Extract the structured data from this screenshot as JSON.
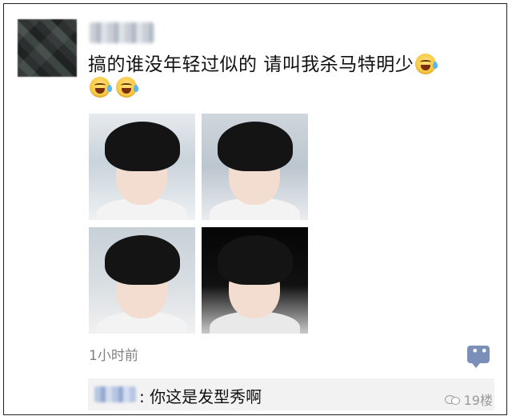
{
  "post": {
    "username": "",
    "text": "搞的谁没年轻过似的 请叫我杀马特明少",
    "emojis": [
      "laugh-cry-emoji",
      "laugh-cry-emoji",
      "laugh-cry-emoji"
    ],
    "photos": [
      {
        "name": "selfie-photo-1"
      },
      {
        "name": "selfie-photo-2"
      },
      {
        "name": "selfie-photo-3"
      },
      {
        "name": "selfie-photo-4"
      }
    ],
    "timestamp": "1小时前"
  },
  "comment": {
    "commenter": "",
    "text": ": 你这是发型秀啊"
  },
  "watermark": {
    "text": "19楼",
    "icon": "wechat-icon"
  },
  "colors": {
    "comment_button": "#7a90b8",
    "timestamp": "#808080",
    "comment_bg": "#f2f2f2",
    "name_blur": "#b7c6e2"
  }
}
